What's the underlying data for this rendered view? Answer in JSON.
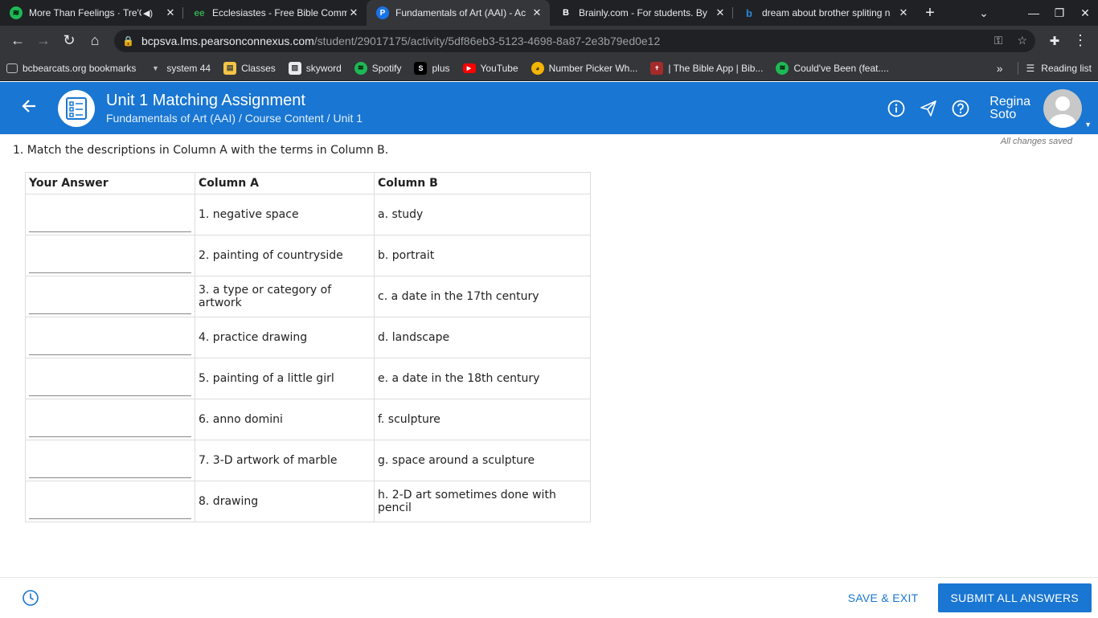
{
  "browser": {
    "tabs": [
      {
        "title": "More Than Feelings · Tre'G",
        "favicon": "spotify-icon",
        "color": "#1db954",
        "audio": true
      },
      {
        "title": "Ecclesiastes - Free Bible Comm",
        "favicon": "ee-icon",
        "color": "#34a853"
      },
      {
        "title": "Fundamentals of Art (AAI) - Ac",
        "favicon": "pearson-icon",
        "color": "#1a73e8"
      },
      {
        "title": "Brainly.com - For students. By",
        "favicon": "brainly-icon",
        "color": "#ffffff"
      },
      {
        "title": "dream about brother spliting n",
        "favicon": "bing-icon",
        "color": "#2b88d8"
      }
    ],
    "url_host": "bcpsva.lms.pearsonconnexus.com",
    "url_path": "/student/29017175/activity/5df86eb3-5123-4698-8a87-2e3b79ed0e12",
    "bookmarks": [
      {
        "label": "bcbearcats.org bookmarks",
        "icon": "folder-icon"
      },
      {
        "label": "system 44",
        "icon": "system44-icon"
      },
      {
        "label": "Classes",
        "icon": "classes-icon"
      },
      {
        "label": "skyword",
        "icon": "skyword-icon"
      },
      {
        "label": "Spotify",
        "icon": "spotify-icon"
      },
      {
        "label": "plus",
        "icon": "plus-s-icon"
      },
      {
        "label": "YouTube",
        "icon": "youtube-icon"
      },
      {
        "label": "Number Picker Wh...",
        "icon": "wheel-icon"
      },
      {
        "label": "| The Bible App | Bib...",
        "icon": "bible-icon"
      },
      {
        "label": "Could've Been (feat....",
        "icon": "spotify-icon"
      }
    ],
    "reading_list": "Reading list",
    "more_bookmarks": "»"
  },
  "header": {
    "title": "Unit 1 Matching Assignment",
    "breadcrumb": "Fundamentals of Art (AAI) / Course Content / Unit 1",
    "user_first": "Regina",
    "user_last": "Soto"
  },
  "assignment": {
    "saved_status": "All changes saved",
    "question": "1. Match the descriptions in Column A with the terms in Column B.",
    "headers": [
      "Your Answer",
      "Column A",
      "Column B"
    ],
    "rows": [
      {
        "answer": "",
        "a": "1. negative space",
        "b": "a. study"
      },
      {
        "answer": "",
        "a": "2. painting of countryside",
        "b": "b. portrait"
      },
      {
        "answer": "",
        "a": "3. a type or category of artwork",
        "b": "c. a date in the 17th century"
      },
      {
        "answer": "",
        "a": "4. practice drawing",
        "b": "d. landscape"
      },
      {
        "answer": "",
        "a": "5. painting of a little girl",
        "b": "e. a date in the 18th century"
      },
      {
        "answer": "",
        "a": "6. anno domini",
        "b": "f. sculpture"
      },
      {
        "answer": "",
        "a": "7. 3-D artwork of marble",
        "b": "g. space around a sculpture"
      },
      {
        "answer": "",
        "a": "8. drawing",
        "b": "h. 2-D art sometimes done with pencil"
      }
    ]
  },
  "footer": {
    "save_exit": "SAVE & EXIT",
    "submit": "SUBMIT ALL ANSWERS"
  },
  "colors": {
    "brand": "#1976d2",
    "chrome_dark": "#202124",
    "chrome_toolbar": "#35363a"
  }
}
